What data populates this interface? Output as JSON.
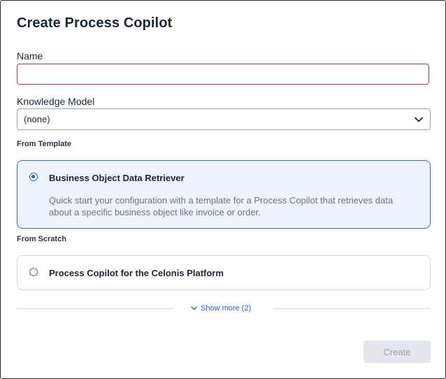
{
  "dialog": {
    "title": "Create Process Copilot"
  },
  "form": {
    "name_label": "Name",
    "name_value": "",
    "knowledge_model_label": "Knowledge Model",
    "knowledge_model_value": "(none)"
  },
  "from_template": {
    "section_label": "From Template",
    "option": {
      "title": "Business Object Data Retriever",
      "description": "Quick start your configuration with a template for a Process Copilot that retrieves data about a specific business object like invoice or order.",
      "selected": true
    }
  },
  "from_scratch": {
    "section_label": "From Scratch",
    "option": {
      "title": "Process Copilot for the Celonis Platform",
      "selected": false
    }
  },
  "show_more": {
    "label": "Show more (2)"
  },
  "actions": {
    "create_label": "Create",
    "create_disabled": true
  },
  "colors": {
    "accent": "#1a64d6",
    "selected_card_bg": "#eef4fd",
    "error_border": "#c9304e"
  }
}
